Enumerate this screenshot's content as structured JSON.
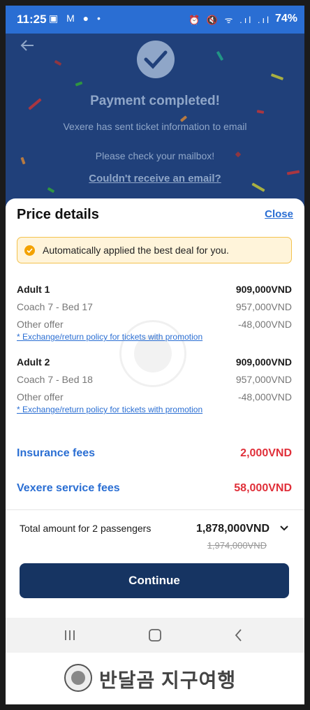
{
  "status_bar": {
    "time": "11:25",
    "left_icons": "▣ M ● •",
    "right_icons": "⏰ 🔇 ᯤ .ıl .ıl",
    "battery": "74%"
  },
  "confirmation": {
    "title": "Payment completed!",
    "line1": "Vexere has sent ticket information to email",
    "line2": "Please check your mailbox!",
    "link": "Couldn't receive an email?"
  },
  "price_details": {
    "title": "Price details",
    "close_label": "Close",
    "deal_notice": "Automatically applied the best deal for you.",
    "passengers": [
      {
        "name": "Adult 1",
        "total": "909,000VND",
        "seat": "Coach 7 - Bed 17",
        "seat_price": "957,000VND",
        "offer_label": "Other offer",
        "offer_value": "-48,000VND",
        "policy_link": "* Exchange/return policy for tickets with promotion"
      },
      {
        "name": "Adult 2",
        "total": "909,000VND",
        "seat": "Coach 7 - Bed 18",
        "seat_price": "957,000VND",
        "offer_label": "Other offer",
        "offer_value": "-48,000VND",
        "policy_link": "* Exchange/return policy for tickets with promotion"
      }
    ],
    "insurance_label": "Insurance fees",
    "insurance_value": "2,000VND",
    "service_label": "Vexere service fees",
    "service_value": "58,000VND"
  },
  "total": {
    "label": "Total amount for 2 passengers",
    "amount": "1,878,000VND",
    "original": "1,974,000VND"
  },
  "continue_label": "Continue",
  "watermark": {
    "text": "반달곰 지구여행"
  },
  "colors": {
    "brand_blue": "#2a6ed3",
    "dark_navy": "#163462",
    "fee_red": "#e0303a",
    "deal_bg": "#fff4da",
    "deal_border": "#f3c24d"
  }
}
